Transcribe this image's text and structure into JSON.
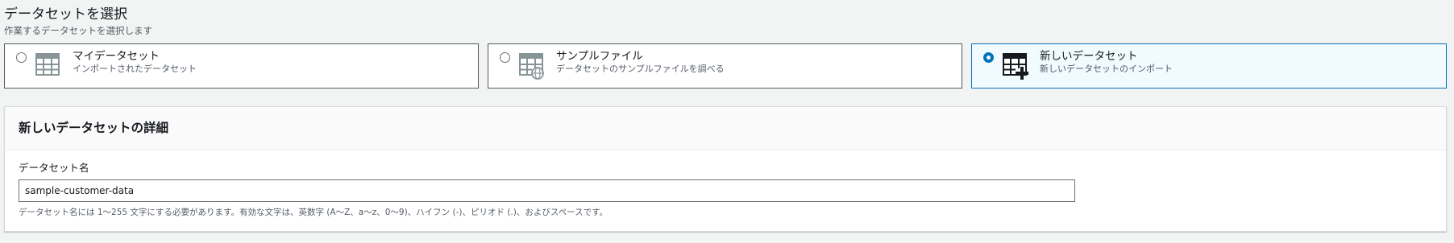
{
  "section": {
    "title": "データセットを選択",
    "description": "作業するデータセットを選択します"
  },
  "tiles": [
    {
      "label": "マイデータセット",
      "sublabel": "インポートされたデータセット",
      "selected": false,
      "icon": "table-icon"
    },
    {
      "label": "サンプルファイル",
      "sublabel": "データセットのサンプルファイルを調べる",
      "selected": false,
      "icon": "table-globe-icon"
    },
    {
      "label": "新しいデータセット",
      "sublabel": "新しいデータセットのインポート",
      "selected": true,
      "icon": "table-add-icon"
    }
  ],
  "details_panel": {
    "title": "新しいデータセットの詳細",
    "name_field": {
      "label": "データセット名",
      "value": "sample-customer-data",
      "hint": "データセット名には 1〜255 文字にする必要があります。有効な文字は、英数字 (A〜Z、a〜z、0〜9)、ハイフン (-)、ピリオド (.)、およびスペースです。"
    }
  },
  "colors": {
    "accent": "#0073bb",
    "selected_tile_bg": "#f1faff",
    "page_bg": "#f2f3f3",
    "muted_text": "#545b64",
    "icon_gray": "#879596"
  }
}
